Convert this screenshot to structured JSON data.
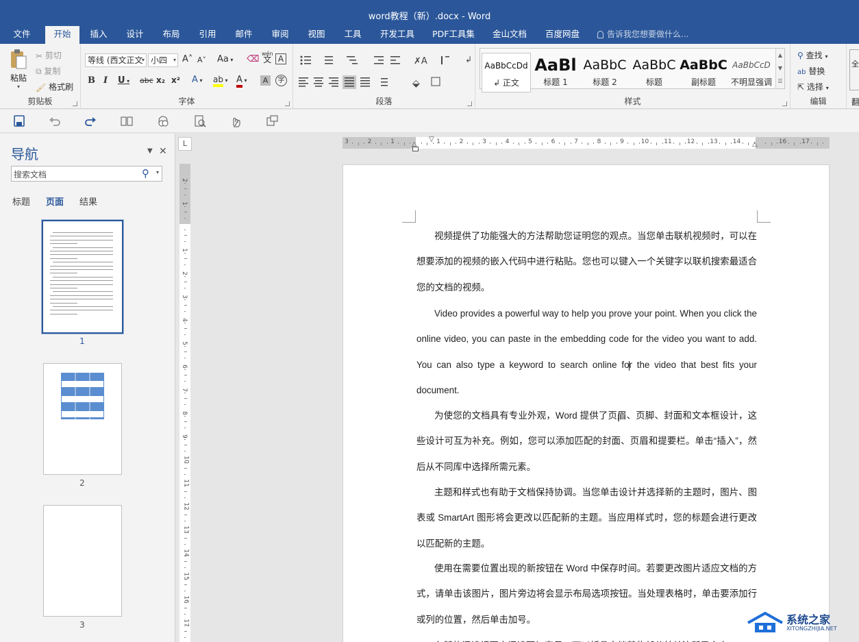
{
  "window": {
    "title": "word教程（新）.docx - Word"
  },
  "ribbon_tabs": [
    "文件",
    "开始",
    "插入",
    "设计",
    "布局",
    "引用",
    "邮件",
    "审阅",
    "视图",
    "工具",
    "开发工具",
    "PDF工具集",
    "金山文档",
    "百度网盘"
  ],
  "active_tab": "开始",
  "tell_me": "告诉我您想要做什么...",
  "clipboard": {
    "paste": "粘贴",
    "cut": "剪切",
    "copy": "复制",
    "format_painter": "格式刷",
    "label": "剪贴板"
  },
  "font": {
    "name": "等线 (西文正文",
    "size": "小四",
    "grow": "A˄",
    "shrink": "A˅",
    "case": "Aa",
    "clear": "Aa",
    "phonetic_top": "wén",
    "phonetic": "文",
    "border": "A",
    "bold": "B",
    "italic": "I",
    "underline": "U",
    "strike": "abc",
    "sub": "x₂",
    "sup": "x²",
    "text_effect": "A",
    "highlight": "ab",
    "color": "A",
    "shade": "A",
    "enclose": "字",
    "label": "字体",
    "accent_color": "#c00000",
    "highlight_color": "#ffff00"
  },
  "paragraph": {
    "label": "段落"
  },
  "styles": {
    "label": "样式",
    "items": [
      {
        "preview": "AaBbCcDd",
        "name": "↲ 正文"
      },
      {
        "preview": "AaBl",
        "name": "标题 1"
      },
      {
        "preview": "AaBbC",
        "name": "标题 2"
      },
      {
        "preview": "AaBbC",
        "name": "标题"
      },
      {
        "preview": "AaBbC",
        "name": "副标题"
      },
      {
        "preview": "AaBbCcD",
        "name": "不明显强调"
      }
    ]
  },
  "editing": {
    "find": "查找",
    "replace": "替换",
    "select": "选择",
    "label": "编辑",
    "extra": "全",
    "extra2": "翻"
  },
  "navigation": {
    "title": "导航",
    "search_placeholder": "搜索文档",
    "tabs": [
      "标题",
      "页面",
      "结果"
    ],
    "active_tab": "页面",
    "pages": [
      "1",
      "2",
      "3"
    ]
  },
  "rulers": {
    "horizontal": [
      "3",
      "2",
      "1",
      "",
      "1",
      "2",
      "3",
      "4",
      "5",
      "6",
      "7",
      "8",
      "9",
      "10",
      "11",
      "12",
      "13",
      "14",
      "",
      "16",
      "17"
    ],
    "vertical": [
      "2",
      "1",
      "",
      "1",
      "2",
      "3",
      "4",
      "5",
      "6",
      "7",
      "8",
      "9",
      "10",
      "11",
      "12",
      "13",
      "14",
      "15",
      "16",
      "17",
      "18"
    ],
    "tab_selector": "L"
  },
  "document": {
    "paragraphs": [
      "视频提供了功能强大的方法帮助您证明您的观点。当您单击联机视频时，可以在想要添加的视频的嵌入代码中进行粘贴。您也可以键入一个关键字以联机搜索最适合您的文档的视频。",
      "Video provides a powerful way to help you prove your point. When you click the online video, you can paste in the embedding code for the video you want to add. You can also type a keyword to search online for the video that best fits your document.",
      "为使您的文档具有专业外观，Word 提供了页眉、页脚、封面和文本框设计，这些设计可互为补充。例如，您可以添加匹配的封面、页眉和提要栏。单击“插入”，然后从不同库中选择所需元素。",
      "主题和样式也有助于文档保持协调。当您单击设计并选择新的主题时，图片、图表或 SmartArt 图形将会更改以匹配新的主题。当应用样式时，您的标题会进行更改以匹配新的主题。",
      "使用在需要位置出现的新按钮在 Word 中保存时间。若要更改图片适应文档的方式，请单击该图片，图片旁边将会显示布局选项按钮。当处理表格时，单击要添加行或列的位置，然后单击加号。",
      "在新的阅读视图中阅读更加容易。可以折叠文档某些部分并关注所需文本。"
    ]
  },
  "watermark": {
    "name": "系统之家",
    "url": "XITONGZHIJIA.NET"
  },
  "colors": {
    "accent": "#2b579a",
    "ribbon": "#f3f3f3",
    "canvas": "#e6e6e6"
  }
}
